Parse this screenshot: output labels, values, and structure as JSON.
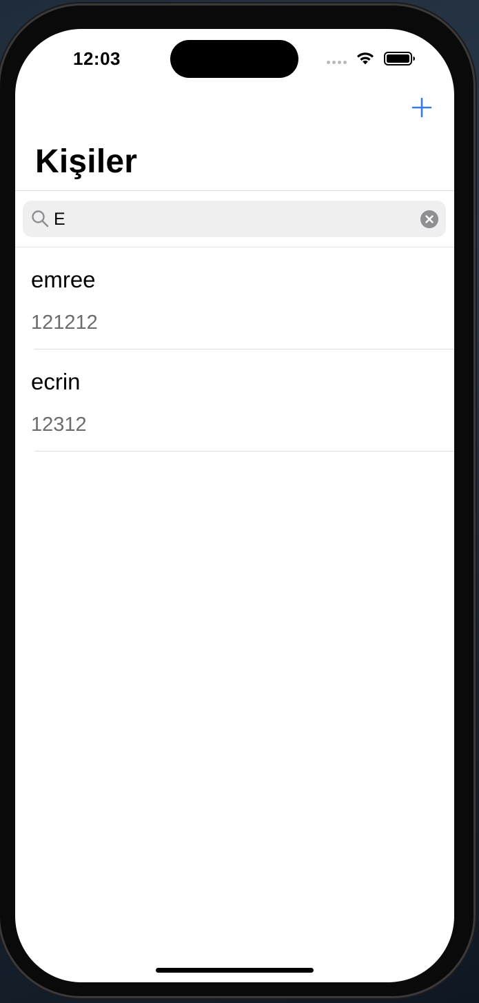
{
  "status_bar": {
    "time": "12:03",
    "wifi_icon": "wifi-icon",
    "battery_icon": "battery-full-icon"
  },
  "nav": {
    "title": "Kişiler",
    "add_icon": "plus-icon",
    "accent_color": "#3478f6"
  },
  "search": {
    "value": "E",
    "search_icon": "magnifying-glass-icon",
    "clear_icon": "clear-circle-icon"
  },
  "contacts": [
    {
      "name": "emree",
      "phone": "121212"
    },
    {
      "name": "ecrin",
      "phone": "12312"
    }
  ]
}
